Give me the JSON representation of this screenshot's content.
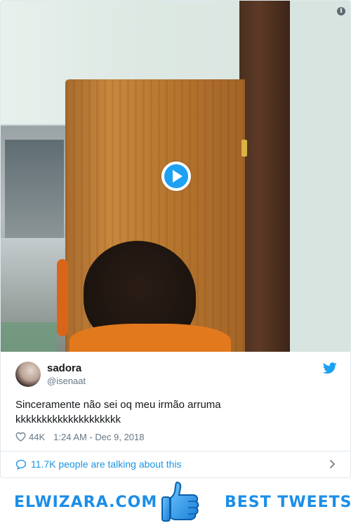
{
  "tweet": {
    "author_name": "sadora",
    "author_handle": "@isenaat",
    "text_line1": "Sinceramente não sei oq meu irmão arruma",
    "text_line2": "kkkkkkkkkkkkkkkkkkkk",
    "likes": "44K",
    "timestamp": "1:24 AM - Dec 9, 2018",
    "talking_about": "11.7K people are talking about this"
  },
  "banner": {
    "site": "ELWIZARA.COM",
    "tagline": "BEST TWEETS"
  },
  "icons": {
    "info": "i",
    "play": "play-icon",
    "twitter": "twitter-bird-icon",
    "heart": "heart-icon",
    "bubble": "speech-bubble-icon",
    "chevron": "chevron-right-icon",
    "thumb": "thumbs-up-icon"
  },
  "colors": {
    "accent": "#1da1f2",
    "link": "#1b95e0",
    "muted": "#657786",
    "banner": "#1c8ee8"
  }
}
